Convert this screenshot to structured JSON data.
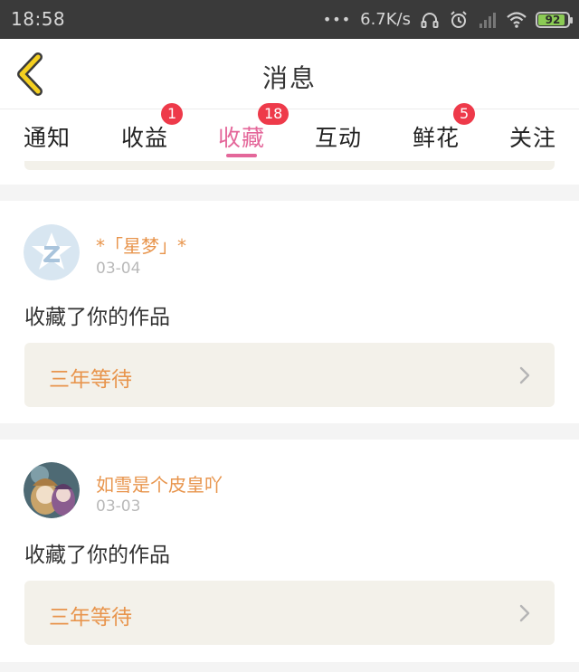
{
  "status_bar": {
    "time": "18:58",
    "dots": "•••",
    "net_speed": "6.7K/s",
    "battery_level": "92",
    "battery_fraction": 0.92,
    "battery_color": "#8bcb54",
    "icons": [
      "headset-icon",
      "alarm-icon",
      "signal-icon",
      "wifi-icon",
      "battery-icon"
    ]
  },
  "header": {
    "title": "消息",
    "back_icon": "chevron-left-icon",
    "back_color": "#f5d020"
  },
  "tabs": [
    {
      "label": "通知",
      "badge": ""
    },
    {
      "label": "收益",
      "badge": "1"
    },
    {
      "label": "收藏",
      "badge": "18",
      "active": true
    },
    {
      "label": "互动",
      "badge": ""
    },
    {
      "label": "鲜花",
      "badge": "5"
    },
    {
      "label": "关注",
      "badge": ""
    }
  ],
  "colors": {
    "accent_pink": "#e4679a",
    "badge_red": "#ee3a4a",
    "name_orange": "#e8954d"
  },
  "messages": [
    {
      "user_name": "*「星梦」*",
      "date": "03-04",
      "text": "收藏了你的作品",
      "work_title": "三年等待",
      "avatar": "qq-default-avatar-icon"
    },
    {
      "user_name": "如雪是个皮皇吖",
      "date": "03-03",
      "text": "收藏了你的作品",
      "work_title": "三年等待",
      "avatar": "anime-avatar-image"
    }
  ]
}
